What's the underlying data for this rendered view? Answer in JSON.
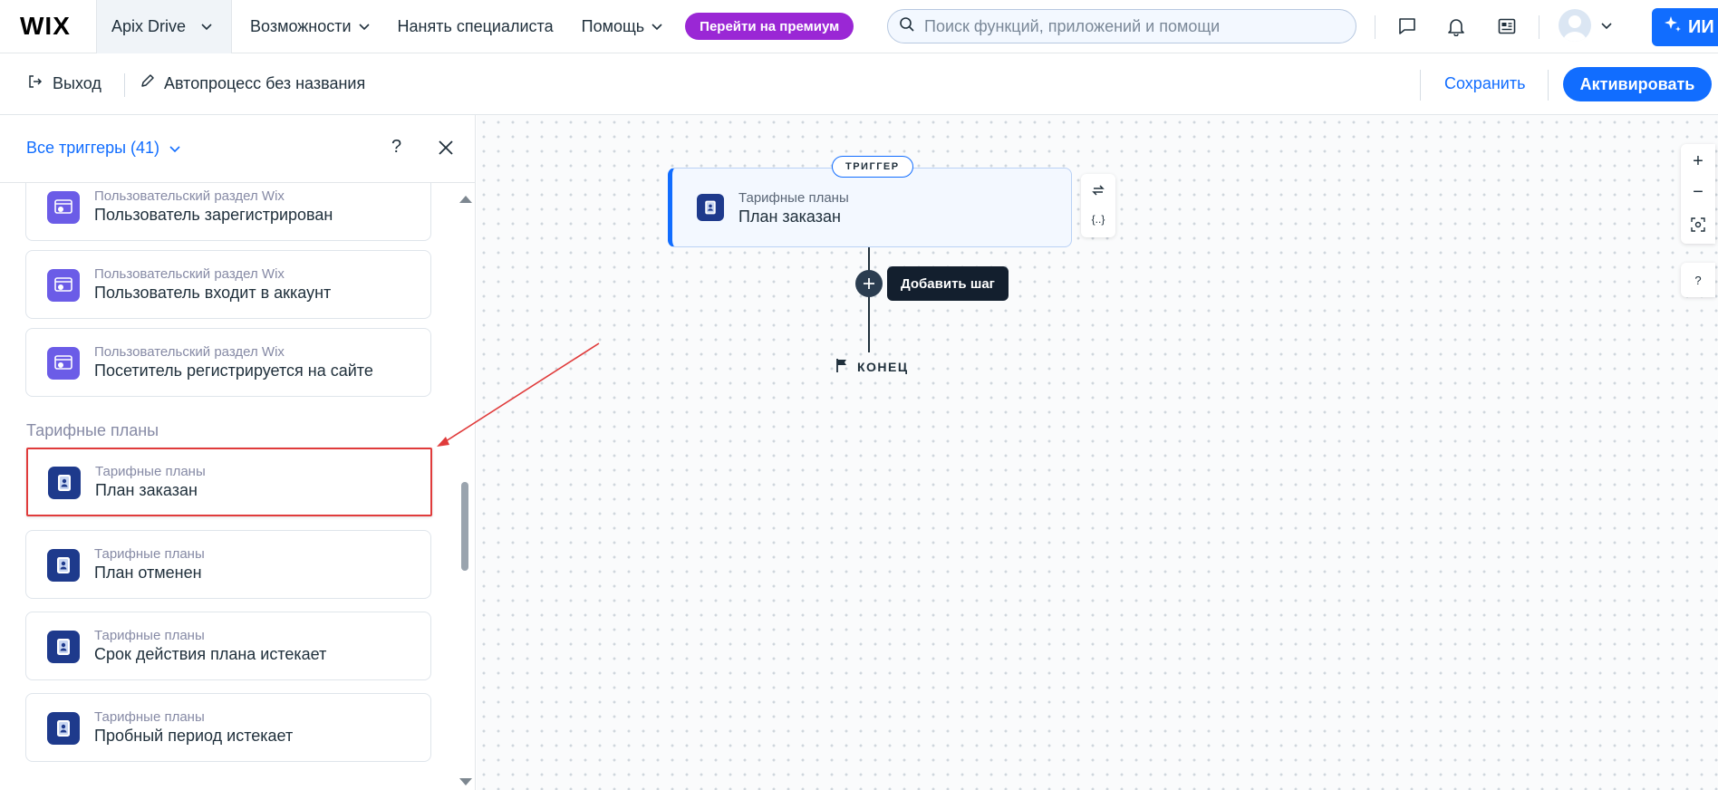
{
  "topbar": {
    "logo": "WIX",
    "site_name": "Apix Drive",
    "nav": [
      {
        "label": "Возможности",
        "has_dropdown": true
      },
      {
        "label": "Нанять специалиста",
        "has_dropdown": false
      },
      {
        "label": "Помощь",
        "has_dropdown": true
      }
    ],
    "premium_label": "Перейти на премиум",
    "search_placeholder": "Поиск функций, приложений и помощи",
    "ai_label": "ИИ",
    "icons": [
      "chat-icon",
      "bell-icon",
      "news-icon"
    ]
  },
  "toolbar": {
    "exit_label": "Выход",
    "process_title": "Автопроцесс без названия",
    "save_label": "Сохранить",
    "activate_label": "Активировать"
  },
  "panel": {
    "triggers_label": "Все триггеры (41)",
    "help": "?",
    "sections": [
      {
        "label": "",
        "items": [
          {
            "category": "Пользовательский раздел Wix",
            "title": "Пользователь зарегистрирован",
            "icon": "members-icon"
          },
          {
            "category": "Пользовательский раздел Wix",
            "title": "Пользователь входит в аккаунт",
            "icon": "members-icon"
          },
          {
            "category": "Пользовательский раздел Wix",
            "title": "Посетитель регистрируется на сайте",
            "icon": "members-icon"
          }
        ]
      },
      {
        "label": "Тарифные планы",
        "items": [
          {
            "category": "Тарифные планы",
            "title": "План заказан",
            "icon": "pricing-plans-icon",
            "selected": true
          },
          {
            "category": "Тарифные планы",
            "title": "План отменен",
            "icon": "pricing-plans-icon"
          },
          {
            "category": "Тарифные планы",
            "title": "Срок действия плана истекает",
            "icon": "pricing-plans-icon"
          },
          {
            "category": "Тарифные планы",
            "title": "Пробный период истекает",
            "icon": "pricing-plans-icon"
          }
        ]
      }
    ]
  },
  "canvas": {
    "trigger_badge": "ТРИГГЕР",
    "trigger": {
      "category": "Тарифные планы",
      "title": "План заказан"
    },
    "variables_label": "{..}",
    "add_step_label": "Добавить шаг",
    "end_label": "КОНЕЦ",
    "zoom_in": "+",
    "zoom_out": "−",
    "help": "?"
  },
  "colors": {
    "accent": "#116dff",
    "premium": "#9a27d5",
    "highlight_annotation": "#e03b3b",
    "members_icon": "#6b5ce7",
    "pricing_icon": "#1e3a8c"
  }
}
